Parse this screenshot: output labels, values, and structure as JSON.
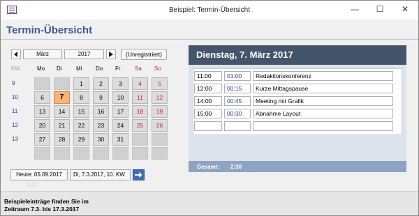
{
  "window": {
    "title": "Beispiel: Termin-Übersicht",
    "min_glyph": "—",
    "max_glyph": "☐",
    "close_glyph": "✕"
  },
  "page": {
    "title": "Termin-Übersicht"
  },
  "calendar": {
    "month": "März",
    "year": "2017",
    "unregistered_label": "(Unregistriert)",
    "kw_header": "KW",
    "weekday_headers": [
      "Mo",
      "Di",
      "Mi",
      "Do",
      "Fr",
      "Sa",
      "So"
    ],
    "weeks": [
      {
        "kw": "9",
        "days": [
          "",
          "",
          "1",
          "2",
          "3",
          "4",
          "5"
        ]
      },
      {
        "kw": "10",
        "days": [
          "6",
          "7",
          "8",
          "9",
          "10",
          "11",
          "12"
        ]
      },
      {
        "kw": "11",
        "days": [
          "13",
          "14",
          "15",
          "16",
          "17",
          "18",
          "19"
        ]
      },
      {
        "kw": "12",
        "days": [
          "20",
          "21",
          "22",
          "23",
          "24",
          "25",
          "26"
        ]
      },
      {
        "kw": "13",
        "days": [
          "27",
          "28",
          "29",
          "30",
          "31",
          "",
          ""
        ]
      },
      {
        "kw": "",
        "days": [
          "",
          "",
          "",
          "",
          "",
          "",
          ""
        ]
      }
    ],
    "selected_day": "7",
    "today_label": "Heute: 05.09.2017",
    "selected_date_label": "Di, 7.3.2017, 10. KW",
    "ghost_text": "2017"
  },
  "appointments": {
    "header_title": "Dienstag, 7. März 2017",
    "rows": [
      {
        "time": "11:00",
        "duration": "01:00",
        "text": "Redaktionskonferenz"
      },
      {
        "time": "12:00",
        "duration": "00:15",
        "text": "Kurze Mittagspause"
      },
      {
        "time": "14:00",
        "duration": "00:45",
        "text": "Meeting mit Grafik"
      },
      {
        "time": "15:00",
        "duration": "00:30",
        "text": "Abnahme Layout"
      },
      {
        "time": "",
        "duration": "",
        "text": ""
      }
    ],
    "total_label": "Gesamt:",
    "total_value": "2:30"
  },
  "footer": {
    "line1": "Beispieleinträge finden Sie im",
    "line2": "Zeitraum 7.3. bis 17.3.2017"
  },
  "colors": {
    "accent": "#3b5a8c",
    "panel_header": "#44546a",
    "total_bar": "#8ea4c4",
    "today_highlight": "#f6b475",
    "weekend_text": "#c0262c",
    "kw_text": "#2b3f9e"
  },
  "icons": [
    "app-icon",
    "arrow-left-icon",
    "arrow-right-icon",
    "go-arrow-icon"
  ]
}
